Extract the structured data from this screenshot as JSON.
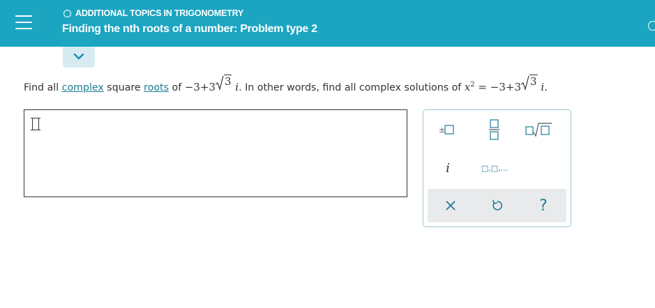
{
  "header": {
    "topic": "ADDITIONAL TOPICS IN TRIGONOMETRY",
    "title": "Finding the nth roots of a number: Problem type 2"
  },
  "question": {
    "part1": "Find all ",
    "link_complex": "complex",
    "part2": " square ",
    "link_roots": "roots",
    "part3": " of ",
    "number_prefix": "−3+3",
    "radicand": "3",
    "imag_unit": "i",
    "part4": ". In other words, find all complex solutions of ",
    "var": "x",
    "exponent": "2",
    "equals": " = −3+3",
    "end": "."
  },
  "keypad": {
    "imag_key": "i",
    "list_key": "□,□,..."
  },
  "colors": {
    "header": "#1ba5c1",
    "accent": "#1f7a99"
  }
}
